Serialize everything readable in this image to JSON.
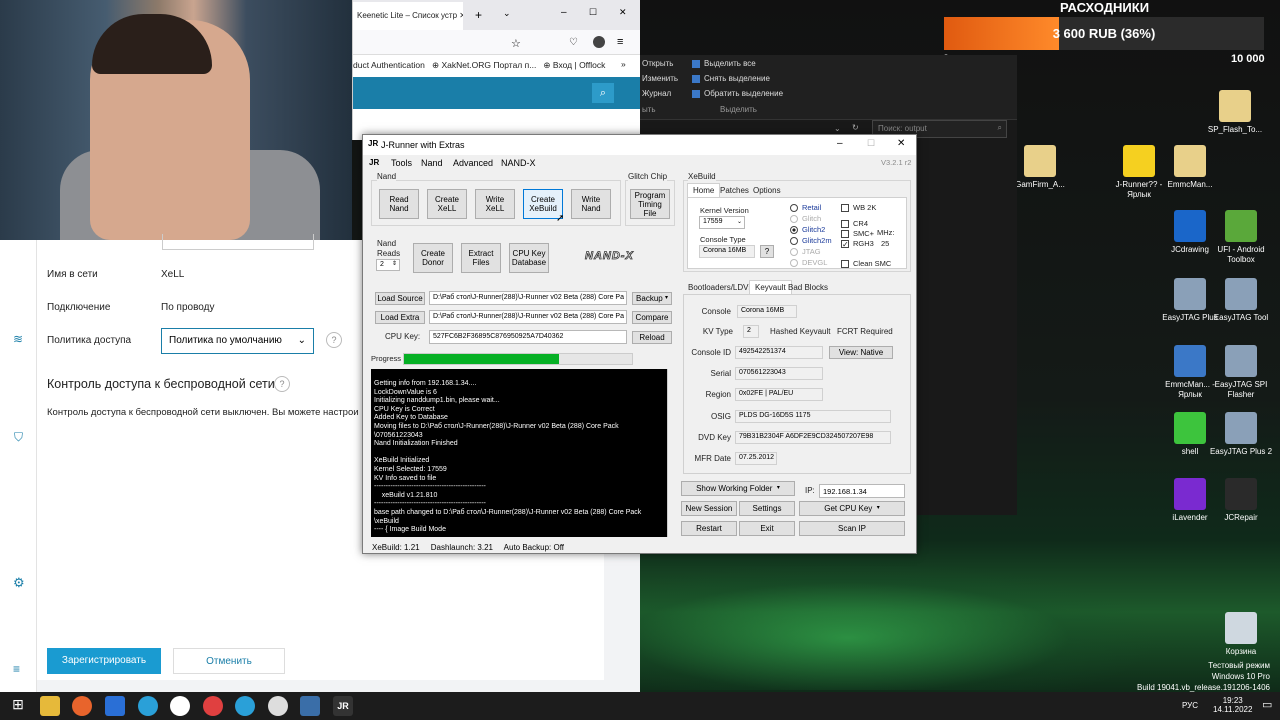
{
  "browser": {
    "tab_title": "Keenetic Lite – Список устр",
    "bookmarks": [
      "duct Authentication",
      "XakNet.ORG Портал п...",
      "Вход | Offlock"
    ]
  },
  "router": {
    "fields": [
      {
        "label": "Имя в сети",
        "value": "XeLL"
      },
      {
        "label": "Подключение",
        "value": "По проводу"
      },
      {
        "label": "Политика доступа",
        "value": "Политика по умолчанию"
      }
    ],
    "section_title": "Контроль доступа к беспроводной сети",
    "section_text": "Контроль доступа к беспроводной сети выключен. Вы можете настрои",
    "register_button": "Зарегистрировать",
    "cancel_button": "Отменить"
  },
  "explorer": {
    "left_items": [
      "Открыть",
      "Изменить",
      "Журнал"
    ],
    "select_items": [
      "Выделить все",
      "Снять выделение",
      "Обратить выделение"
    ],
    "group_left": "ыть",
    "group_select": "Выделить",
    "search_placeholder": "Поиск: output"
  },
  "donation": {
    "title": "РАСХОДНИКИ",
    "amount": "3 600 RUB (36%)",
    "progress": 0.36,
    "min": "0",
    "max": "10 000"
  },
  "desktop_icons": [
    {
      "label": "SP_Flash_To...",
      "color": "#e8d08a"
    },
    {
      "label": "GamFirm_A...",
      "color": "#e8d08a"
    },
    {
      "label": "J-Runner?? - Ярлык",
      "color": "#f5d020"
    },
    {
      "label": "EmmcMan...",
      "color": "#e8d08a"
    },
    {
      "label": "JCdrawing",
      "color": "#1a66c9"
    },
    {
      "label": "UFI - Android Toolbox",
      "color": "#5aa83a"
    },
    {
      "label": "EasyJTAG Plus",
      "color": "#8aa0b8"
    },
    {
      "label": "EasyJTAG Tool",
      "color": "#8aa0b8"
    },
    {
      "label": "EmmcMan... - Ярлык",
      "color": "#3b78c7"
    },
    {
      "label": "EasyJTAG SPI Flasher",
      "color": "#8aa0b8"
    },
    {
      "label": "shell",
      "color": "#3dc43d"
    },
    {
      "label": "EasyJTAG Plus 2",
      "color": "#8aa0b8"
    },
    {
      "label": "iLavender",
      "color": "#7a2ad0"
    },
    {
      "label": "JCRepair",
      "color": "#2a2a2a"
    },
    {
      "label": "Корзина",
      "color": "#cfd8e0"
    }
  ],
  "jr": {
    "title": "J-Runner with Extras",
    "menu": [
      "Tools",
      "Nand",
      "Advanced",
      "NAND-X"
    ],
    "version": "V3.2.1 r2",
    "nand_group": "Nand",
    "nand_buttons": [
      "Read Nand",
      "Create XeLL",
      "Write XeLL",
      "Create XeBuild",
      "Write Nand"
    ],
    "glitch_group": "Glitch Chip",
    "glitch_button": "Program Timing File",
    "nand_reads_label": "Nand Reads",
    "nand_reads_value": "2",
    "row2_buttons": [
      "Create Donor",
      "Extract Files",
      "CPU Key Database"
    ],
    "nandx_logo": "NAND-X",
    "xebuild_group": "XeBuild",
    "xebuild_tabs": [
      "Home",
      "Patches",
      "Options"
    ],
    "kernel_label": "Kernel Version",
    "kernel_value": "17559",
    "console_type_label": "Console Type",
    "console_type_value": "Corona 16MB",
    "help": "?",
    "radios": [
      {
        "label": "Retail",
        "state": "normal"
      },
      {
        "label": "Glitch",
        "state": "disabled"
      },
      {
        "label": "Glitch2",
        "state": "on"
      },
      {
        "label": "Glitch2m",
        "state": "normal"
      },
      {
        "label": "JTAG",
        "state": "disabled"
      },
      {
        "label": "DEVGL",
        "state": "disabled"
      }
    ],
    "checks": [
      {
        "label": "WB 2K",
        "checked": false
      },
      {
        "label": "CR4",
        "checked": false
      },
      {
        "label": "SMC+",
        "checked": false
      },
      {
        "label": "RGH3",
        "checked": true
      },
      {
        "label": "Clean SMC",
        "checked": false
      }
    ],
    "mhz_label": "MHz:",
    "mhz_value": "25",
    "load_source": "Load Source",
    "load_source_path": "D:\\Раб стол\\J-Runner(288)\\J-Runner v02 Beta (288) Core Pa",
    "backup": "Backup",
    "load_extra": "Load Extra",
    "load_extra_path": "D:\\Раб стол\\J-Runner(288)\\J-Runner v02 Beta (288) Core Pa",
    "compare": "Compare",
    "cpu_key_label": "CPU Key:",
    "cpu_key_value": "527FC6B2F36895C876950925A7D40362",
    "reload": "Reload",
    "progress_label": "Progress",
    "progress_value": 0.68,
    "console_log": "Getting info from 192.168.1.34....\nLockDownValue is 6\nInitializing nanddump1.bin, please wait...\nCPU Key is Correct\nAdded Key to Database\nMoving files to D:\\Раб стол\\J-Runner(288)\\J-Runner v02 Beta (288) Core Pack\n\\070561223043\nNand Initialization Finished\n\nXeBuild Initialized\nKernel Selected: 17559\nKV Info saved to file\n------------------------------------------------\n    xeBuild v1.21.810\n------------------------------------------------\nbase path changed to D:\\Раб стол\\J-Runner(288)\\J-Runner v02 Beta (288) Core Pack\n\\xeBuild\n---- { Image Build Mode",
    "info_tabs": [
      "Bootloaders/LDVs",
      "Keyvault",
      "Bad Blocks"
    ],
    "info": [
      {
        "label": "Console",
        "value": "Corona 16MB"
      },
      {
        "label": "KV Type",
        "value": "2"
      },
      {
        "label": "Console ID",
        "value": "492542251374"
      },
      {
        "label": "Serial",
        "value": "070561223043"
      },
      {
        "label": "Region",
        "value": "0x02FE  |  PAL/EU"
      },
      {
        "label": "OSIG",
        "value": "PLDS   DG-16D5S       1175"
      },
      {
        "label": "DVD Key",
        "value": "79B31B2304F A6DF2E9CD324507207E98"
      },
      {
        "label": "MFR Date",
        "value": "07.25.2012"
      }
    ],
    "hashed_kv": "Hashed Keyvault",
    "fcrt": "FCRT Required",
    "view_native": "View: Native",
    "show_working_folder": "Show Working Folder",
    "ip_label": "IP:",
    "ip_value": "192.168.1.34",
    "new_session": "New Session",
    "settings": "Settings",
    "get_cpu_key": "Get CPU Key",
    "restart": "Restart",
    "exit": "Exit",
    "scan_ip": "Scan IP",
    "status": [
      "XeBuild:  1.21",
      "Dashlaunch:  3.21",
      "Auto Backup: Off"
    ]
  },
  "watermark": [
    "Тестовый режим",
    "Windows 10 Pro",
    "Build 19041.vb_release.191206-1406"
  ],
  "tray": {
    "lang": "РУС",
    "time": "19:23",
    "date": "14.11.2022"
  }
}
